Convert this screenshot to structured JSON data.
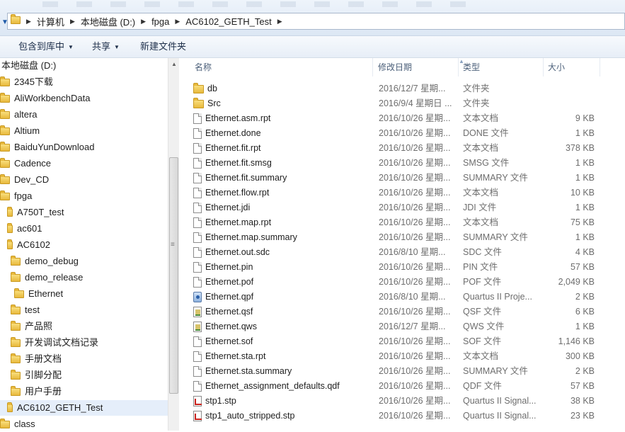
{
  "address_bar": {
    "crumbs": [
      "计算机",
      "本地磁盘 (D:)",
      "fpga",
      "AC6102_GETH_Test"
    ]
  },
  "toolbar": {
    "include_library": "包含到库中",
    "share": "共享",
    "new_folder": "新建文件夹"
  },
  "nav_pane": {
    "root": "本地磁盘 (D:)",
    "items": [
      {
        "label": "2345下载"
      },
      {
        "label": "AliWorkbenchData"
      },
      {
        "label": "altera"
      },
      {
        "label": "Altium"
      },
      {
        "label": "BaiduYunDownload"
      },
      {
        "label": "Cadence"
      },
      {
        "label": "Dev_CD"
      },
      {
        "label": "fpga"
      },
      {
        "label": "A750T_test"
      },
      {
        "label": "ac601"
      },
      {
        "label": "AC6102"
      },
      {
        "label": "demo_debug"
      },
      {
        "label": "demo_release"
      },
      {
        "label": "Ethernet"
      },
      {
        "label": "test"
      },
      {
        "label": "产品照"
      },
      {
        "label": "开发调试文档记录"
      },
      {
        "label": "手册文档"
      },
      {
        "label": "引脚分配"
      },
      {
        "label": "用户手册"
      },
      {
        "label": "AC6102_GETH_Test",
        "selected": true
      },
      {
        "label": "class"
      }
    ]
  },
  "columns": {
    "name": "名称",
    "date": "修改日期",
    "type": "类型",
    "size": "大小"
  },
  "files": [
    {
      "name": "db",
      "date": "2016/12/7 星期...",
      "type": "文件夹",
      "size": "",
      "icon": "folder-icon"
    },
    {
      "name": "Src",
      "date": "2016/9/4 星期日 ...",
      "type": "文件夹",
      "size": "",
      "icon": "folder-icon"
    },
    {
      "name": "Ethernet.asm.rpt",
      "date": "2016/10/26 星期...",
      "type": "文本文档",
      "size": "9 KB",
      "icon": "document-icon"
    },
    {
      "name": "Ethernet.done",
      "date": "2016/10/26 星期...",
      "type": "DONE 文件",
      "size": "1 KB",
      "icon": "document-icon"
    },
    {
      "name": "Ethernet.fit.rpt",
      "date": "2016/10/26 星期...",
      "type": "文本文档",
      "size": "378 KB",
      "icon": "document-icon"
    },
    {
      "name": "Ethernet.fit.smsg",
      "date": "2016/10/26 星期...",
      "type": "SMSG 文件",
      "size": "1 KB",
      "icon": "document-icon"
    },
    {
      "name": "Ethernet.fit.summary",
      "date": "2016/10/26 星期...",
      "type": "SUMMARY 文件",
      "size": "1 KB",
      "icon": "document-icon"
    },
    {
      "name": "Ethernet.flow.rpt",
      "date": "2016/10/26 星期...",
      "type": "文本文档",
      "size": "10 KB",
      "icon": "document-icon"
    },
    {
      "name": "Ethernet.jdi",
      "date": "2016/10/26 星期...",
      "type": "JDI 文件",
      "size": "1 KB",
      "icon": "document-icon"
    },
    {
      "name": "Ethernet.map.rpt",
      "date": "2016/10/26 星期...",
      "type": "文本文档",
      "size": "75 KB",
      "icon": "document-icon"
    },
    {
      "name": "Ethernet.map.summary",
      "date": "2016/10/26 星期...",
      "type": "SUMMARY 文件",
      "size": "1 KB",
      "icon": "document-icon"
    },
    {
      "name": "Ethernet.out.sdc",
      "date": "2016/8/10 星期...",
      "type": "SDC 文件",
      "size": "4 KB",
      "icon": "document-icon"
    },
    {
      "name": "Ethernet.pin",
      "date": "2016/10/26 星期...",
      "type": "PIN 文件",
      "size": "57 KB",
      "icon": "document-icon"
    },
    {
      "name": "Ethernet.pof",
      "date": "2016/10/26 星期...",
      "type": "POF 文件",
      "size": "2,049 KB",
      "icon": "document-icon"
    },
    {
      "name": "Ethernet.qpf",
      "date": "2016/8/10 星期...",
      "type": "Quartus II Proje...",
      "size": "2 KB",
      "icon": "quartus-project-icon"
    },
    {
      "name": "Ethernet.qsf",
      "date": "2016/10/26 星期...",
      "type": "QSF 文件",
      "size": "6 KB",
      "icon": "qsf-file-icon"
    },
    {
      "name": "Ethernet.qws",
      "date": "2016/12/7 星期...",
      "type": "QWS 文件",
      "size": "1 KB",
      "icon": "qsf-file-icon"
    },
    {
      "name": "Ethernet.sof",
      "date": "2016/10/26 星期...",
      "type": "SOF 文件",
      "size": "1,146 KB",
      "icon": "document-icon"
    },
    {
      "name": "Ethernet.sta.rpt",
      "date": "2016/10/26 星期...",
      "type": "文本文档",
      "size": "300 KB",
      "icon": "document-icon"
    },
    {
      "name": "Ethernet.sta.summary",
      "date": "2016/10/26 星期...",
      "type": "SUMMARY 文件",
      "size": "2 KB",
      "icon": "document-icon"
    },
    {
      "name": "Ethernet_assignment_defaults.qdf",
      "date": "2016/10/26 星期...",
      "type": "QDF 文件",
      "size": "57 KB",
      "icon": "document-icon"
    },
    {
      "name": "stp1.stp",
      "date": "2016/10/26 星期...",
      "type": "Quartus II Signal...",
      "size": "38 KB",
      "icon": "signaltap-file-icon"
    },
    {
      "name": "stp1_auto_stripped.stp",
      "date": "2016/10/26 星期...",
      "type": "Quartus II Signal...",
      "size": "23 KB",
      "icon": "signaltap-file-icon"
    }
  ]
}
